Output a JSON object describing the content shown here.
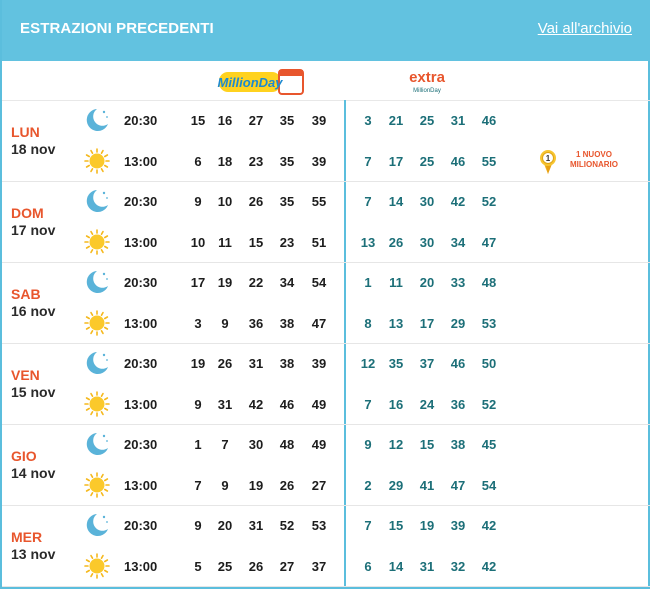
{
  "header": {
    "title": "ESTRAZIONI PRECEDENTI",
    "link": "Vai all'archivio"
  },
  "logos": {
    "millionday": "MillionDay",
    "extra_main": "extra",
    "extra_sub": "MillionDay"
  },
  "badge": {
    "count": "1",
    "line1": "1 NUOVO",
    "line2": "MILIONARIO"
  },
  "days": [
    {
      "name": "LUN",
      "date": "18 nov",
      "draws": [
        {
          "time": "20:30",
          "icon": "moon-icon",
          "numbers": [
            15,
            16,
            27,
            35,
            39
          ],
          "extra": [
            3,
            21,
            25,
            31,
            46
          ]
        },
        {
          "time": "13:00",
          "icon": "sun-icon",
          "numbers": [
            6,
            18,
            23,
            35,
            39
          ],
          "extra": [
            7,
            17,
            25,
            46,
            55
          ]
        }
      ]
    },
    {
      "name": "DOM",
      "date": "17 nov",
      "draws": [
        {
          "time": "20:30",
          "icon": "moon-icon",
          "numbers": [
            9,
            10,
            26,
            35,
            55
          ],
          "extra": [
            7,
            14,
            30,
            42,
            52
          ]
        },
        {
          "time": "13:00",
          "icon": "sun-icon",
          "numbers": [
            10,
            11,
            15,
            23,
            51
          ],
          "extra": [
            13,
            26,
            30,
            34,
            47
          ]
        }
      ]
    },
    {
      "name": "SAB",
      "date": "16 nov",
      "draws": [
        {
          "time": "20:30",
          "icon": "moon-icon",
          "numbers": [
            17,
            19,
            22,
            34,
            54
          ],
          "extra": [
            1,
            11,
            20,
            33,
            48
          ]
        },
        {
          "time": "13:00",
          "icon": "sun-icon",
          "numbers": [
            3,
            9,
            36,
            38,
            47
          ],
          "extra": [
            8,
            13,
            17,
            29,
            53
          ]
        }
      ]
    },
    {
      "name": "VEN",
      "date": "15 nov",
      "draws": [
        {
          "time": "20:30",
          "icon": "moon-icon",
          "numbers": [
            19,
            26,
            31,
            38,
            39
          ],
          "extra": [
            12,
            35,
            37,
            46,
            50
          ]
        },
        {
          "time": "13:00",
          "icon": "sun-icon",
          "numbers": [
            9,
            31,
            42,
            46,
            49
          ],
          "extra": [
            7,
            16,
            24,
            36,
            52
          ]
        }
      ]
    },
    {
      "name": "GIO",
      "date": "14 nov",
      "draws": [
        {
          "time": "20:30",
          "icon": "moon-icon",
          "numbers": [
            1,
            7,
            30,
            48,
            49
          ],
          "extra": [
            9,
            12,
            15,
            38,
            45
          ]
        },
        {
          "time": "13:00",
          "icon": "sun-icon",
          "numbers": [
            7,
            9,
            19,
            26,
            27
          ],
          "extra": [
            2,
            29,
            41,
            47,
            54
          ]
        }
      ]
    },
    {
      "name": "MER",
      "date": "13 nov",
      "draws": [
        {
          "time": "20:30",
          "icon": "moon-icon",
          "numbers": [
            9,
            20,
            31,
            52,
            53
          ],
          "extra": [
            7,
            15,
            19,
            39,
            42
          ]
        },
        {
          "time": "13:00",
          "icon": "sun-icon",
          "numbers": [
            5,
            25,
            26,
            27,
            37
          ],
          "extra": [
            6,
            14,
            31,
            32,
            42
          ]
        }
      ]
    }
  ]
}
